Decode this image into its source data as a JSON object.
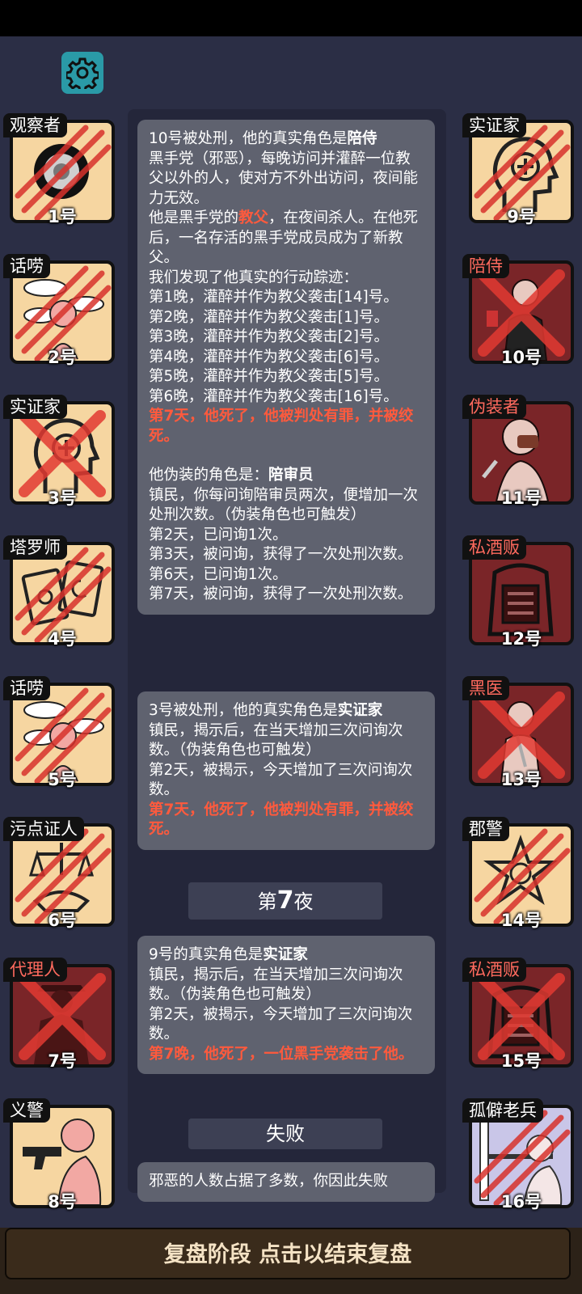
{
  "left_players": [
    {
      "role": "观察者",
      "number": "1号",
      "theme": "light",
      "label_color": "white",
      "mark": "scratch",
      "icon": "observer-eye-icon"
    },
    {
      "role": "话唠",
      "number": "2号",
      "theme": "light",
      "label_color": "white",
      "mark": "scratch",
      "icon": "chatterbox-icon"
    },
    {
      "role": "实证家",
      "number": "3号",
      "theme": "light",
      "label_color": "white",
      "mark": "cross",
      "icon": "empiricist-head-icon"
    },
    {
      "role": "塔罗师",
      "number": "4号",
      "theme": "light",
      "label_color": "white",
      "mark": "scratch",
      "icon": "tarot-cards-icon"
    },
    {
      "role": "话唠",
      "number": "5号",
      "theme": "light",
      "label_color": "white",
      "mark": "scratch",
      "icon": "chatterbox-icon"
    },
    {
      "role": "污点证人",
      "number": "6号",
      "theme": "light",
      "label_color": "white",
      "mark": "scratch",
      "icon": "scales-handshake-icon"
    },
    {
      "role": "代理人",
      "number": "7号",
      "theme": "dark",
      "label_color": "red",
      "mark": "cross",
      "icon": "agent-coat-icon"
    },
    {
      "role": "义警",
      "number": "8号",
      "theme": "light",
      "label_color": "white",
      "mark": "none",
      "icon": "vigilante-gun-icon"
    }
  ],
  "right_players": [
    {
      "role": "实证家",
      "number": "9号",
      "theme": "light",
      "label_color": "white",
      "mark": "scratch",
      "icon": "empiricist-head-icon"
    },
    {
      "role": "陪侍",
      "number": "10号",
      "theme": "dark",
      "label_color": "red",
      "mark": "cross",
      "icon": "escort-figure-icon"
    },
    {
      "role": "伪装者",
      "number": "11号",
      "theme": "dark",
      "label_color": "red",
      "mark": "none",
      "icon": "disguiser-mask-icon"
    },
    {
      "role": "私酒贩",
      "number": "12号",
      "theme": "dark",
      "label_color": "red",
      "mark": "none",
      "icon": "bootlegger-coat-icon"
    },
    {
      "role": "黑医",
      "number": "13号",
      "theme": "dark",
      "label_color": "red",
      "mark": "cross",
      "icon": "black-doctor-icon"
    },
    {
      "role": "郡警",
      "number": "14号",
      "theme": "light",
      "label_color": "white",
      "mark": "scratch",
      "icon": "sheriff-badge-icon"
    },
    {
      "role": "私酒贩",
      "number": "15号",
      "theme": "dark",
      "label_color": "red",
      "mark": "cross",
      "icon": "bootlegger-coat-icon"
    },
    {
      "role": "孤僻老兵",
      "number": "16号",
      "theme": "lav",
      "label_color": "white",
      "mark": "scratch",
      "icon": "veteran-icon"
    }
  ],
  "messages": {
    "m1": {
      "l1a": "10号被处刑，他的真实角色是",
      "l1b": "陪侍",
      "l2": "黑手党（邪恶），每晚访问并灌醉一位教父以外的人，使对方不外出访问，夜间能力无效。",
      "l3a": "他是黑手党的",
      "l3b": "教父",
      "l3c": "，在夜间杀人。在他死后，一名存活的黑手党成员成为了新教父。",
      "l4": "我们发现了他真实的行动踪迹：",
      "n1": "第1晚，灌醉并作为教父袭击[14]号。",
      "n2": "第2晚，灌醉并作为教父袭击[1]号。",
      "n3": "第3晚，灌醉并作为教父袭击[2]号。",
      "n4": "第4晚，灌醉并作为教父袭击[6]号。",
      "n5": "第5晚，灌醉并作为教父袭击[5]号。",
      "n6": "第6晚，灌醉并作为教父袭击[16]号。",
      "death": "第7天，他死了，他被判处有罪，并被绞死。",
      "d1a": "他伪装的角色是：",
      "d1b": "陪审员",
      "d2": "镇民，你每问询陪审员两次，便增加一次处刑次数。（伪装角色也可触发）",
      "d3": "第2天，已问询1次。",
      "d4": "第3天，被问询，获得了一次处刑次数。",
      "d5": "第6天，已问询1次。",
      "d6": "第7天，被问询，获得了一次处刑次数。"
    },
    "m2": {
      "l1a": "3号被处刑，他的真实角色是",
      "l1b": "实证家",
      "l2": "镇民，揭示后，在当天增加三次问询次数。（伪装角色也可触发）",
      "l3": "第2天，被揭示，今天增加了三次问询次数。",
      "death": "第7天，他死了，他被判处有罪，并被绞死。"
    },
    "night_sep_prefix": "第",
    "night_sep_num": "7",
    "night_sep_suffix": "夜",
    "m3": {
      "l1a": "9号的真实角色是",
      "l1b": "实证家",
      "l2": "镇民，揭示后，在当天增加三次问询次数。（伪装角色也可触发）",
      "l3": "第2天，被揭示，今天增加了三次问询次数。",
      "death": "第7晚，他死了，一位黑手党袭击了他。"
    },
    "result_sep": "失败",
    "m4": {
      "text": "邪恶的人数占据了多数，你因此失败"
    }
  },
  "bottom_button": "复盘阶段 点击以结束复盘",
  "colors": {
    "background": "#2b2e45",
    "message_bg": "#5f626f",
    "highlight_red": "#ff5a3d",
    "tile_light": "#f6d6a1",
    "tile_dark": "#7a2528",
    "gear_bg": "#2a9aa7"
  }
}
